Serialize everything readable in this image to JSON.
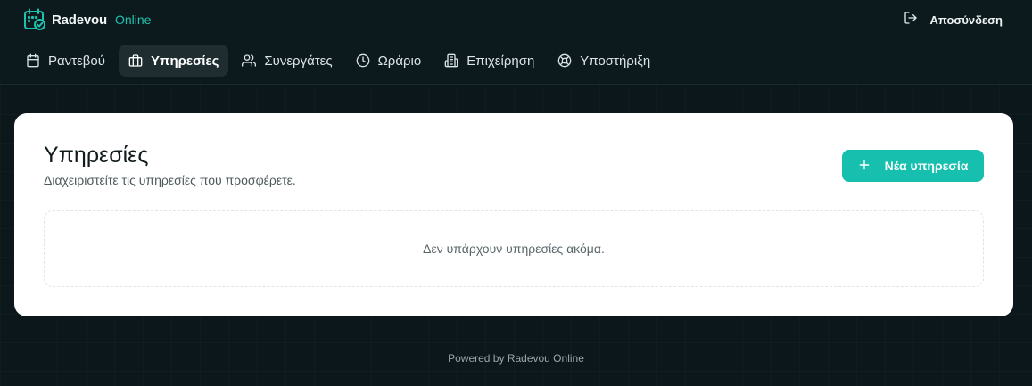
{
  "brand": {
    "name": "Radevou",
    "sub": "Online",
    "accent": "#1fc2ad"
  },
  "header": {
    "logout_label": "Αποσύνδεση",
    "logout_icon": "logout-icon"
  },
  "nav": {
    "items": [
      {
        "label": "Ραντεβού",
        "icon": "calendar-icon",
        "active": false
      },
      {
        "label": "Υπηρεσίες",
        "icon": "briefcase-icon",
        "active": true
      },
      {
        "label": "Συνεργάτες",
        "icon": "users-icon",
        "active": false
      },
      {
        "label": "Ωράριο",
        "icon": "clock-icon",
        "active": false
      },
      {
        "label": "Επιχείρηση",
        "icon": "building-icon",
        "active": false
      },
      {
        "label": "Υποστήριξη",
        "icon": "lifebuoy-icon",
        "active": false
      }
    ]
  },
  "main": {
    "title": "Υπηρεσίες",
    "subtitle": "Διαχειριστείτε τις υπηρεσίες που προσφέρετε.",
    "new_button_label": "Νέα υπηρεσία",
    "new_button_icon": "plus-icon",
    "empty_text": "Δεν υπάρχουν υπηρεσίες ακόμα."
  },
  "footer": {
    "text": "Powered by Radevou Online"
  },
  "colors": {
    "background": "#0b171a",
    "card": "#ffffff",
    "primary": "#16bfae"
  }
}
